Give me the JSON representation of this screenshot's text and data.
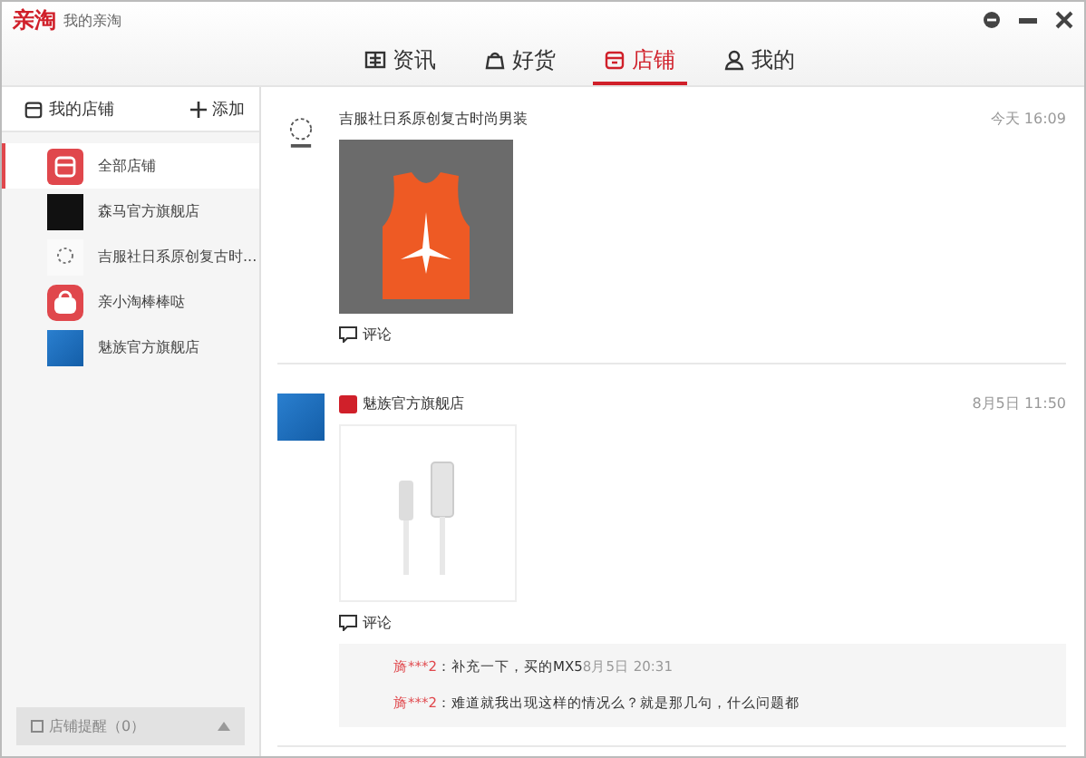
{
  "window": {
    "logo": "亲淘",
    "title": "我的亲淘"
  },
  "tabs": [
    {
      "label": "资讯",
      "selected": false
    },
    {
      "label": "好货",
      "selected": false
    },
    {
      "label": "店铺",
      "selected": true
    },
    {
      "label": "我的",
      "selected": false
    }
  ],
  "sidebar": {
    "title": "我的店铺",
    "add": "添加",
    "items": [
      {
        "name": "全部店铺",
        "selected": true
      },
      {
        "name": "森马官方旗舰店",
        "selected": false
      },
      {
        "name": "吉服社日系原创复古时...",
        "selected": false
      },
      {
        "name": "亲小淘棒棒哒",
        "selected": false
      },
      {
        "name": "魅族官方旗舰店",
        "selected": false
      }
    ],
    "reminder": "店铺提醒（0）"
  },
  "posts": [
    {
      "shop": "吉服社日系原创复古时尚男装",
      "badge": false,
      "time": "今天 16:09",
      "comment": "评论"
    },
    {
      "shop": "魅族官方旗舰店",
      "badge": true,
      "time": "8月5日 11:50",
      "comment": "评论",
      "replies": [
        {
          "user": "旖***2",
          "text": "：补充一下，买的MX5",
          "time": "8月5日 20:31"
        },
        {
          "user": "旖***2",
          "text": "：难道就我出现这样的情况么？就是那几句，什么问题都"
        }
      ]
    }
  ]
}
